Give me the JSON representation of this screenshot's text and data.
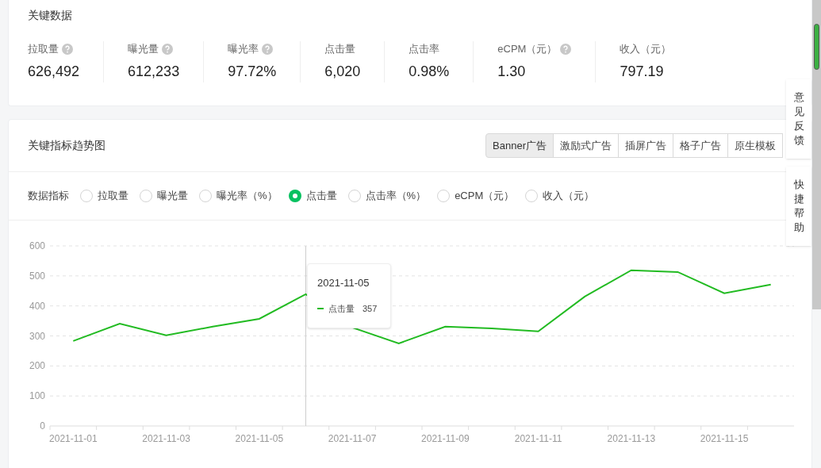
{
  "key_data": {
    "title": "关键数据",
    "metrics": [
      {
        "label": "拉取量",
        "help": true,
        "value": "626,492"
      },
      {
        "label": "曝光量",
        "help": true,
        "value": "612,233"
      },
      {
        "label": "曝光率",
        "help": true,
        "value": "97.72%"
      },
      {
        "label": "点击量",
        "help": false,
        "value": "6,020"
      },
      {
        "label": "点击率",
        "help": false,
        "value": "0.98%"
      },
      {
        "label": "eCPM（元）",
        "help": true,
        "value": "1.30"
      },
      {
        "label": "收入（元）",
        "help": false,
        "value": "797.19"
      }
    ]
  },
  "trend": {
    "title": "关键指标趋势图",
    "tabs": [
      {
        "label": "Banner广告",
        "selected": true
      },
      {
        "label": "激励式广告",
        "selected": false
      },
      {
        "label": "插屏广告",
        "selected": false
      },
      {
        "label": "格子广告",
        "selected": false
      },
      {
        "label": "原生模板",
        "selected": false
      }
    ],
    "metric_label": "数据指标",
    "metric_options": [
      {
        "label": "拉取量",
        "selected": false
      },
      {
        "label": "曝光量",
        "selected": false
      },
      {
        "label": "曝光率（%）",
        "selected": false
      },
      {
        "label": "点击量",
        "selected": true
      },
      {
        "label": "点击率（%）",
        "selected": false
      },
      {
        "label": "eCPM（元）",
        "selected": false
      },
      {
        "label": "收入（元）",
        "selected": false
      }
    ],
    "chart_data": {
      "type": "line",
      "categories": [
        "2021-11-01",
        null,
        "2021-11-03",
        null,
        "2021-11-05",
        null,
        "2021-11-07",
        null,
        "2021-11-09",
        null,
        "2021-11-11",
        null,
        "2021-11-13",
        null,
        "2021-11-15",
        null
      ],
      "grid": true,
      "series": [
        {
          "name": "点击量",
          "color": "#22bb22",
          "values": [
            283,
            341,
            302,
            331,
            357,
            439,
            328,
            275,
            331,
            325,
            315,
            431,
            519,
            513,
            442,
            471
          ]
        }
      ],
      "ylim": [
        0,
        600
      ],
      "yticks": [
        0,
        100,
        200,
        300,
        400,
        500,
        600
      ]
    },
    "tooltip": {
      "date": "2021-11-05",
      "value": "357"
    }
  },
  "side_buttons": [
    "意见反馈",
    "快捷帮助"
  ]
}
